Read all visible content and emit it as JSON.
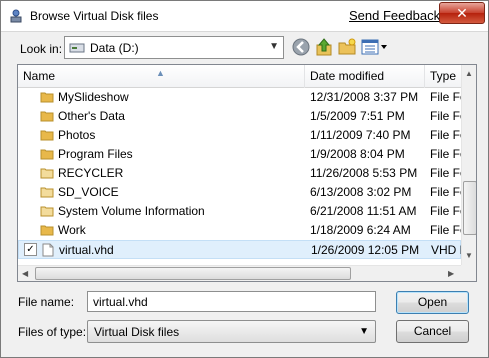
{
  "window": {
    "title": "Browse Virtual Disk files",
    "feedback_link": "Send Feedback",
    "close_glyph": "✕"
  },
  "toolbar": {
    "look_in_label": "Look in:",
    "look_in_value": "Data (D:)",
    "icons": [
      "back-icon",
      "up-folder-icon",
      "new-folder-icon",
      "views-menu-icon"
    ]
  },
  "file_list": {
    "columns": [
      "Name",
      "Date modified",
      "Type"
    ],
    "rows": [
      {
        "name": "MySlideshow",
        "date": "12/31/2008 3:37 PM",
        "type": "File Fo",
        "kind": "folder"
      },
      {
        "name": "Other's Data",
        "date": "1/5/2009 7:51 PM",
        "type": "File Fo",
        "kind": "folder"
      },
      {
        "name": "Photos",
        "date": "1/11/2009 7:40 PM",
        "type": "File Fo",
        "kind": "folder"
      },
      {
        "name": "Program Files",
        "date": "1/9/2008 8:04 PM",
        "type": "File Fo",
        "kind": "folder"
      },
      {
        "name": "RECYCLER",
        "date": "11/26/2008 5:53 PM",
        "type": "File Fo",
        "kind": "folder-hidden"
      },
      {
        "name": "SD_VOICE",
        "date": "6/13/2008 3:02 PM",
        "type": "File Fo",
        "kind": "folder-hidden"
      },
      {
        "name": "System Volume Information",
        "date": "6/21/2008 11:51 AM",
        "type": "File Fo",
        "kind": "folder-hidden"
      },
      {
        "name": "Work",
        "date": "1/18/2009 6:24 AM",
        "type": "File Fo",
        "kind": "folder"
      },
      {
        "name": "virtual.vhd",
        "date": "1/26/2009 12:05 PM",
        "type": "VHD F",
        "kind": "file",
        "selected": true,
        "checked": true
      }
    ]
  },
  "bottom": {
    "file_name_label": "File name:",
    "file_name_value": "virtual.vhd",
    "files_of_type_label": "Files of type:",
    "files_of_type_value": "Virtual Disk files",
    "open_label": "Open",
    "cancel_label": "Cancel"
  },
  "colors": {
    "folder": "#e8b84a",
    "folder_hidden": "#f3dc9c",
    "selection": "#e0effc",
    "accent_border": "#3c7fb1"
  }
}
